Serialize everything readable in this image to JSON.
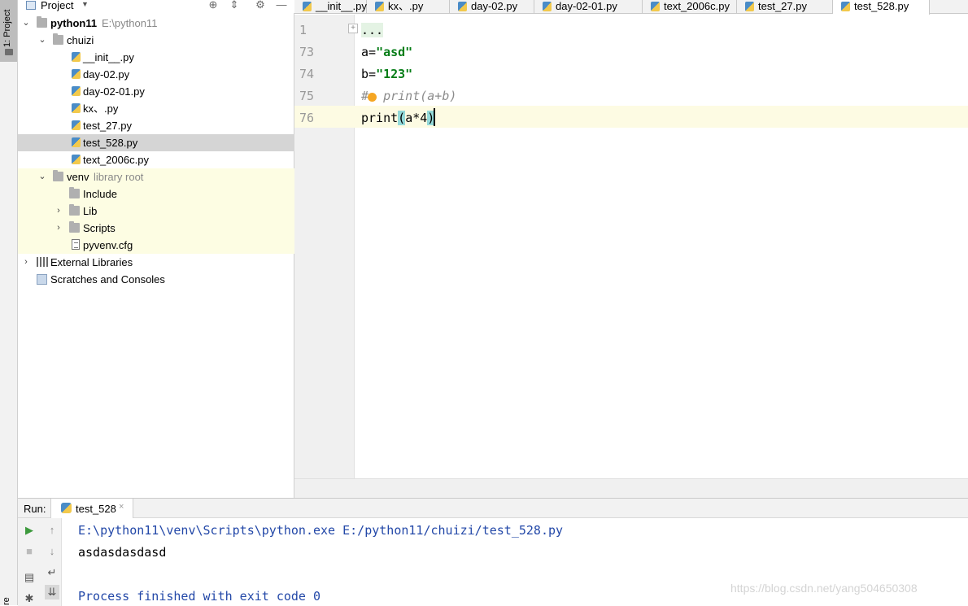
{
  "stripe": {
    "project_tab": "1: Project",
    "bottom_tab": "re"
  },
  "project": {
    "title": "Project",
    "dropdown": "▼",
    "tree": [
      {
        "label": "python11",
        "path": "E:\\python11",
        "type": "folder",
        "bold": true,
        "indent": 0,
        "arrow": "⌄"
      },
      {
        "label": "chuizi",
        "type": "folder",
        "indent": 1,
        "arrow": "⌄"
      },
      {
        "label": "__init__.py",
        "type": "py",
        "indent": 2
      },
      {
        "label": "day-02.py",
        "type": "py",
        "indent": 2
      },
      {
        "label": "day-02-01.py",
        "type": "py",
        "indent": 2
      },
      {
        "label": "kx、.py",
        "type": "py",
        "indent": 2
      },
      {
        "label": "test_27.py",
        "type": "py",
        "indent": 2
      },
      {
        "label": "test_528.py",
        "type": "py",
        "indent": 2,
        "selected": true
      },
      {
        "label": "text_2006c.py",
        "type": "py",
        "indent": 2
      },
      {
        "label": "venv",
        "path": "library root",
        "type": "folder",
        "indent": 1,
        "arrow": "⌄"
      },
      {
        "label": "Include",
        "type": "folder",
        "indent": 2
      },
      {
        "label": "Lib",
        "type": "folder",
        "indent": 2,
        "arrow": "›"
      },
      {
        "label": "Scripts",
        "type": "folder",
        "indent": 2,
        "arrow": "›"
      },
      {
        "label": "pyvenv.cfg",
        "type": "cfg",
        "indent": 2
      },
      {
        "label": "External Libraries",
        "type": "lib",
        "indent": 0,
        "arrow": "›"
      },
      {
        "label": "Scratches and Consoles",
        "type": "scratch",
        "indent": 0
      }
    ]
  },
  "tabs": [
    {
      "label": "__init__.py"
    },
    {
      "label": "kx、.py"
    },
    {
      "label": "day-02.py"
    },
    {
      "label": "day-02-01.py"
    },
    {
      "label": "text_2006c.py"
    },
    {
      "label": "test_27.py"
    },
    {
      "label": "test_528.py",
      "active": true
    }
  ],
  "editor": {
    "line_numbers": [
      "1",
      "73",
      "74",
      "75",
      "76"
    ],
    "fold_marker": "+",
    "line1": "...",
    "line2_prefix": "a=",
    "line2_string": "\"asd\"",
    "line3_prefix": "b=",
    "line3_string": "\"123\"",
    "line4_comment": "#  print(a+b)",
    "line5_fn": "print",
    "line5_open": "(",
    "line5_args": "a*4",
    "line5_close": ")"
  },
  "run": {
    "label": "Run:",
    "tab_label": "test_528",
    "tab_close": "×",
    "buttons": {
      "run": "▶",
      "up": "↑",
      "stop": "■",
      "down": "↓",
      "layout": "▤",
      "wrap": "↵",
      "scroll": "⇊",
      "pin": "✱"
    },
    "console": [
      {
        "text": "E:\\python11\\venv\\Scripts\\python.exe E:/python11/chuizi/test_528.py",
        "kind": "cmd"
      },
      {
        "text": "asdasdasdasd",
        "kind": "stdout"
      },
      {
        "text": "",
        "kind": "stdout"
      },
      {
        "text": "Process finished with exit code 0",
        "kind": "cmd"
      }
    ]
  },
  "watermark": "https://blog.csdn.net/yang504650308"
}
